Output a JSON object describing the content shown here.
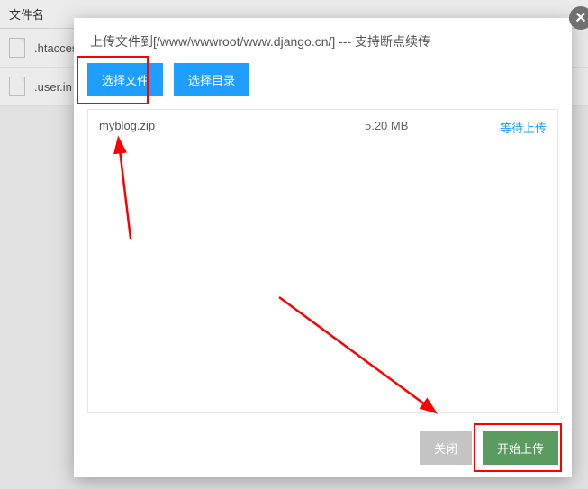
{
  "background": {
    "column_header": "文件名",
    "rows": [
      {
        "name": ".htacces"
      },
      {
        "name": ".user.in"
      }
    ]
  },
  "modal": {
    "title": "上传文件到[/www/wwwroot/www.django.cn/] --- 支持断点续传",
    "toolbar": {
      "select_file": "选择文件",
      "select_dir": "选择目录"
    },
    "file_list": [
      {
        "name": "myblog.zip",
        "size": "5.20 MB",
        "status": "等待上传"
      }
    ],
    "footer": {
      "close": "关闭",
      "start_upload": "开始上传"
    }
  }
}
